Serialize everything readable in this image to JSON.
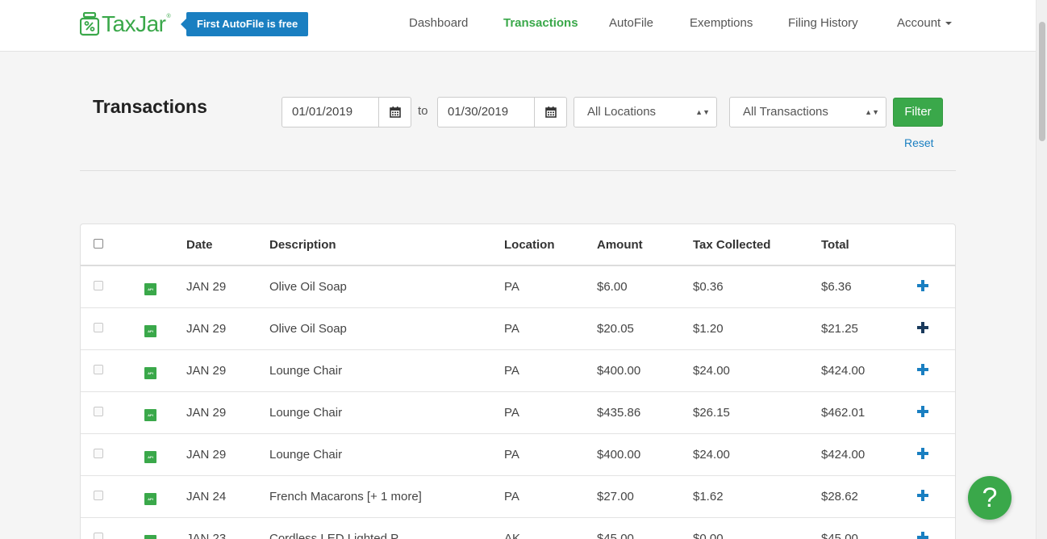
{
  "header": {
    "logo_text": "TaxJar",
    "logo_mark": "®",
    "promo": "First AutoFile is free",
    "nav": [
      {
        "label": "Dashboard",
        "active": false
      },
      {
        "label": "Transactions",
        "active": true
      },
      {
        "label": "AutoFile",
        "active": false
      },
      {
        "label": "Exemptions",
        "active": false
      },
      {
        "label": "Filing History",
        "active": false
      },
      {
        "label": "Account",
        "active": false
      }
    ]
  },
  "page": {
    "title": "Transactions",
    "date_from": "01/01/2019",
    "date_to": "01/30/2019",
    "to_label": "to",
    "locations_select": "All Locations",
    "transactions_select": "All Transactions",
    "filter_label": "Filter",
    "reset_label": "Reset"
  },
  "table": {
    "columns": [
      "Date",
      "Description",
      "Location",
      "Amount",
      "Tax Collected",
      "Total"
    ],
    "rows": [
      {
        "source": "API",
        "date": "JAN 29",
        "description": "Olive Oil Soap",
        "location": "PA",
        "amount": "$6.00",
        "tax": "$0.36",
        "total": "$6.36"
      },
      {
        "source": "API",
        "date": "JAN 29",
        "description": "Olive Oil Soap",
        "location": "PA",
        "amount": "$20.05",
        "tax": "$1.20",
        "total": "$21.25"
      },
      {
        "source": "API",
        "date": "JAN 29",
        "description": "Lounge Chair",
        "location": "PA",
        "amount": "$400.00",
        "tax": "$24.00",
        "total": "$424.00"
      },
      {
        "source": "API",
        "date": "JAN 29",
        "description": "Lounge Chair",
        "location": "PA",
        "amount": "$435.86",
        "tax": "$26.15",
        "total": "$462.01"
      },
      {
        "source": "API",
        "date": "JAN 29",
        "description": "Lounge Chair",
        "location": "PA",
        "amount": "$400.00",
        "tax": "$24.00",
        "total": "$424.00"
      },
      {
        "source": "API",
        "date": "JAN 24",
        "description": "French Macarons [+ 1 more]",
        "location": "PA",
        "amount": "$27.00",
        "tax": "$1.62",
        "total": "$28.62"
      },
      {
        "source": "API",
        "date": "JAN 23",
        "description": "Cordless LED Lighted P",
        "location": "AK",
        "amount": "$45.00",
        "tax": "$0.00",
        "total": "$45.00"
      }
    ]
  },
  "help": {
    "label": "?"
  },
  "colors": {
    "brand_green": "#3aa84a",
    "link_blue": "#1a7fc1"
  }
}
